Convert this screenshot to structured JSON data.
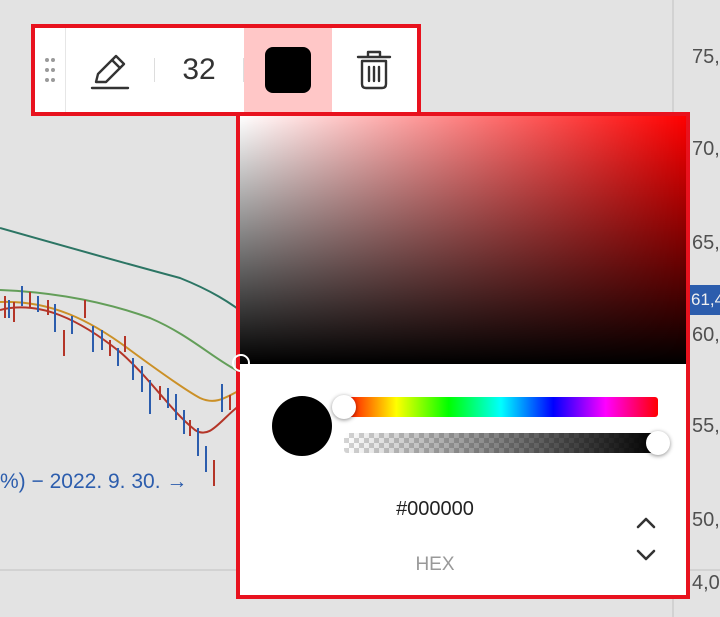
{
  "chart": {
    "price_labels": [
      "75,",
      "70,",
      "65,",
      "60,",
      "55,",
      "50,",
      "4,0"
    ],
    "current_price_badge": "61,4",
    "annotation_text": "%) − 2022. 9. 30. →",
    "colors": {
      "line_long": "#2f7d6b",
      "line_mid": "#6aa85f",
      "line_short_a": "#d89a2a",
      "line_short_b": "#c0392b",
      "candle_up": "#c0392b",
      "candle_down": "#2f63b8",
      "annotation": "#2f63b8"
    }
  },
  "toolbar": {
    "drag_handle_icon": "drag-handle-icon",
    "pen_icon": "pencil-icon",
    "stroke_size": "32",
    "selected_color": "#000000",
    "delete_icon": "trash-icon",
    "highlight_color": "#e8121e"
  },
  "color_picker": {
    "hue_color": "#ff0000",
    "hue_position": 0.0,
    "alpha_position": 1.0,
    "current_color": "#000000",
    "hex_value": "#000000",
    "format_label": "HEX",
    "format_toggle_icon": "chevron-up-down-icon"
  }
}
